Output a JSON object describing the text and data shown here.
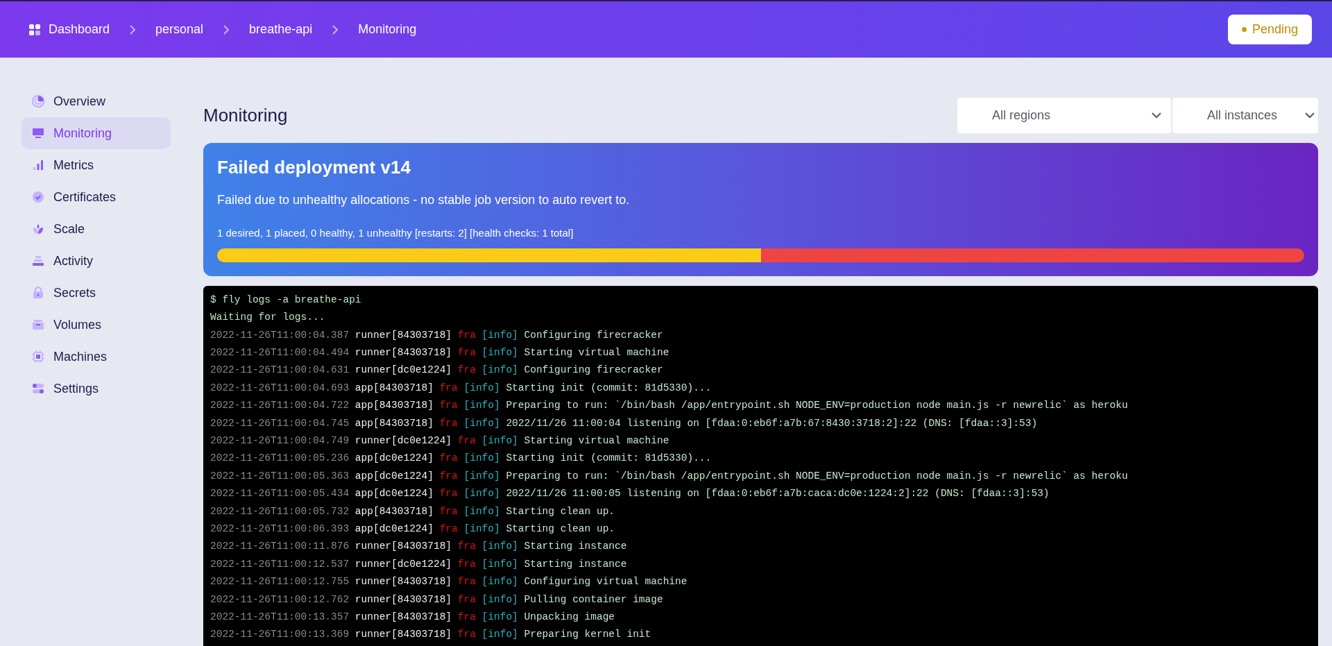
{
  "breadcrumb": [
    {
      "label": "Dashboard"
    },
    {
      "label": "personal"
    },
    {
      "label": "breathe-api"
    },
    {
      "label": "Monitoring"
    }
  ],
  "status_badge": {
    "label": "Pending"
  },
  "sidebar": {
    "items": [
      {
        "label": "Overview",
        "selected": false
      },
      {
        "label": "Monitoring",
        "selected": true
      },
      {
        "label": "Metrics",
        "selected": false
      },
      {
        "label": "Certificates",
        "selected": false
      },
      {
        "label": "Scale",
        "selected": false
      },
      {
        "label": "Activity",
        "selected": false
      },
      {
        "label": "Secrets",
        "selected": false
      },
      {
        "label": "Volumes",
        "selected": false
      },
      {
        "label": "Machines",
        "selected": false
      },
      {
        "label": "Settings",
        "selected": false
      }
    ]
  },
  "page_title": "Monitoring",
  "filters": [
    {
      "value": "All regions"
    },
    {
      "value": "All instances"
    }
  ],
  "deployment": {
    "title": "Failed deployment v14",
    "message": "Failed due to unhealthy allocations - no stable job version to auto revert to.",
    "summary": "1 desired, 1 placed, 0 healthy, 1 unhealthy [restarts: 2] [health checks: 1 total]",
    "level": 0.5
  },
  "terminal": {
    "lines": [
      "$ fly logs -a breathe-api",
      "Waiting for logs..."
    ],
    "entries": [
      {
        "timestamp": "2022-11-26T11:00:04.387",
        "source": "runner[84303718]",
        "region": "fra",
        "level": "[info]",
        "message": "Configuring firecracker"
      },
      {
        "timestamp": "2022-11-26T11:00:04.494",
        "source": "runner[84303718]",
        "region": "fra",
        "level": "[info]",
        "message": "Starting virtual machine"
      },
      {
        "timestamp": "2022-11-26T11:00:04.631",
        "source": "runner[dc0e1224]",
        "region": "fra",
        "level": "[info]",
        "message": "Configuring firecracker"
      },
      {
        "timestamp": "2022-11-26T11:00:04.693",
        "source": "app[84303718]",
        "region": "fra",
        "level": "[info]",
        "message": "Starting init (commit: 81d5330)..."
      },
      {
        "timestamp": "2022-11-26T11:00:04.722",
        "source": "app[84303718]",
        "region": "fra",
        "level": "[info]",
        "message": "Preparing to run: `/bin/bash /app/entrypoint.sh NODE_ENV=production node main.js -r newrelic` as heroku"
      },
      {
        "timestamp": "2022-11-26T11:00:04.745",
        "source": "app[84303718]",
        "region": "fra",
        "level": "[info]",
        "message": "2022/11/26 11:00:04 listening on [fdaa:0:eb6f:a7b:67:8430:3718:2]:22 (DNS: [fdaa::3]:53)"
      },
      {
        "timestamp": "2022-11-26T11:00:04.749",
        "source": "runner[dc0e1224]",
        "region": "fra",
        "level": "[info]",
        "message": "Starting virtual machine"
      },
      {
        "timestamp": "2022-11-26T11:00:05.236",
        "source": "app[dc0e1224]",
        "region": "fra",
        "level": "[info]",
        "message": "Starting init (commit: 81d5330)..."
      },
      {
        "timestamp": "2022-11-26T11:00:05.363",
        "source": "app[dc0e1224]",
        "region": "fra",
        "level": "[info]",
        "message": "Preparing to run: `/bin/bash /app/entrypoint.sh NODE_ENV=production node main.js -r newrelic` as heroku"
      },
      {
        "timestamp": "2022-11-26T11:00:05.434",
        "source": "app[dc0e1224]",
        "region": "fra",
        "level": "[info]",
        "message": "2022/11/26 11:00:05 listening on [fdaa:0:eb6f:a7b:caca:dc0e:1224:2]:22 (DNS: [fdaa::3]:53)"
      },
      {
        "timestamp": "2022-11-26T11:00:05.732",
        "source": "app[84303718]",
        "region": "fra",
        "level": "[info]",
        "message": "Starting clean up."
      },
      {
        "timestamp": "2022-11-26T11:00:06.393",
        "source": "app[dc0e1224]",
        "region": "fra",
        "level": "[info]",
        "message": "Starting clean up."
      },
      {
        "timestamp": "2022-11-26T11:00:11.876",
        "source": "runner[84303718]",
        "region": "fra",
        "level": "[info]",
        "message": "Starting instance"
      },
      {
        "timestamp": "2022-11-26T11:00:12.537",
        "source": "runner[dc0e1224]",
        "region": "fra",
        "level": "[info]",
        "message": "Starting instance"
      },
      {
        "timestamp": "2022-11-26T11:00:12.755",
        "source": "runner[84303718]",
        "region": "fra",
        "level": "[info]",
        "message": "Configuring virtual machine"
      },
      {
        "timestamp": "2022-11-26T11:00:12.762",
        "source": "runner[84303718]",
        "region": "fra",
        "level": "[info]",
        "message": "Pulling container image"
      },
      {
        "timestamp": "2022-11-26T11:00:13.357",
        "source": "runner[84303718]",
        "region": "fra",
        "level": "[info]",
        "message": "Unpacking image"
      },
      {
        "timestamp": "2022-11-26T11:00:13.369",
        "source": "runner[84303718]",
        "region": "fra",
        "level": "[info]",
        "message": "Preparing kernel init"
      }
    ]
  }
}
